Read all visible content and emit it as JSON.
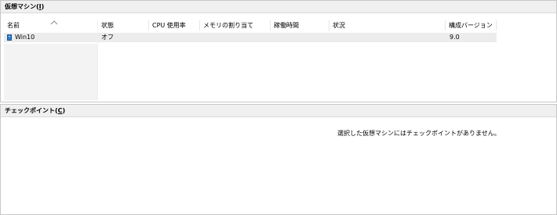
{
  "vm_panel": {
    "title": "仮想マシン(",
    "title_mnemonic": "I",
    "title_close": ")",
    "columns": [
      "名前",
      "状態",
      "CPU 使用率",
      "メモリの割り当て",
      "稼働時間",
      "状況",
      "構成バージョン"
    ],
    "rows": [
      {
        "name": "Win10",
        "state": "オフ",
        "cpu": "",
        "memory": "",
        "uptime": "",
        "status": "",
        "version": "9.0",
        "icon": "vm-icon"
      }
    ]
  },
  "checkpoint_panel": {
    "title": "チェックポイント(",
    "title_mnemonic": "C",
    "title_close": ")",
    "empty_message": "選択した仮想マシンにはチェックポイントがありません。"
  },
  "colors": {
    "header_bg": "#f0f0f0",
    "row_bg": "#ececec",
    "vm_icon": "#2f7cc6"
  }
}
